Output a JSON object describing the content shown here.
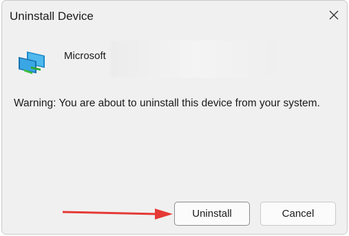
{
  "dialog": {
    "title": "Uninstall Device",
    "close_icon": "close-icon",
    "device_icon": "network-adapter-icon",
    "device_name": "Microsoft",
    "warning": "Warning: You are about to uninstall this device from your system.",
    "uninstall_label": "Uninstall",
    "cancel_label": "Cancel"
  },
  "annotation": {
    "arrow_color": "#e53935",
    "arrow_icon": "red-arrow-icon"
  },
  "colors": {
    "dialog_bg": "#f0f0f0",
    "button_bg": "#fbfbfb"
  }
}
